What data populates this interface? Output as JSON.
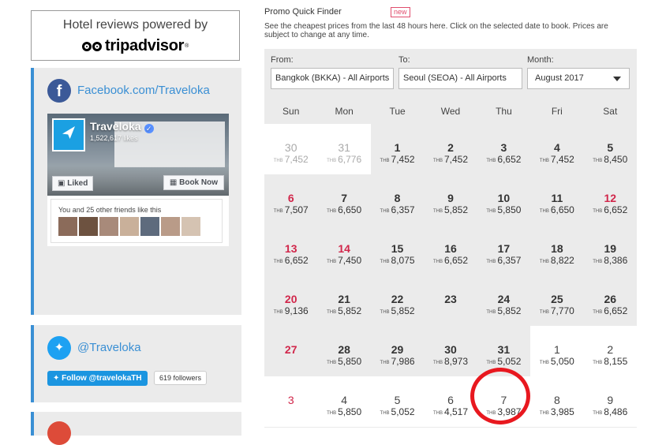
{
  "tripadvisor": {
    "title": "Hotel reviews powered by",
    "logo": "tripadvisor"
  },
  "facebook": {
    "link": "Facebook.com/Traveloka",
    "page_name": "Traveloka",
    "likes": "1,522,617 likes",
    "liked_label": "Liked",
    "book_label": "Book Now",
    "friends_text": "You and 25 other friends like this"
  },
  "twitter": {
    "link": "@Traveloka",
    "follow_label": "Follow @travelokaTH",
    "followers": "619 followers"
  },
  "promo": {
    "title": "Promo Quick Finder",
    "badge": "new",
    "description": "See the cheapest prices from the last 48 hours here. Click on the selected date to book. Prices are subject to change at any time.",
    "from_label": "From:",
    "from_value": "Bangkok (BKKA) - All Airports",
    "to_label": "To:",
    "to_value": "Seoul (SEOA) - All Airports",
    "month_label": "Month:",
    "month_value": "August 2017",
    "currency": "THB",
    "days": [
      "Sun",
      "Mon",
      "Tue",
      "Wed",
      "Thu",
      "Fri",
      "Sat"
    ],
    "weeks": [
      [
        {
          "d": "30",
          "p": "7,452",
          "s": "muted"
        },
        {
          "d": "31",
          "p": "6,776",
          "s": "muted"
        },
        {
          "d": "1",
          "p": "7,452",
          "s": ""
        },
        {
          "d": "2",
          "p": "7,452",
          "s": ""
        },
        {
          "d": "3",
          "p": "6,652",
          "s": ""
        },
        {
          "d": "4",
          "p": "7,452",
          "s": ""
        },
        {
          "d": "5",
          "p": "8,450",
          "s": ""
        }
      ],
      [
        {
          "d": "6",
          "p": "7,507",
          "s": "red"
        },
        {
          "d": "7",
          "p": "6,650",
          "s": ""
        },
        {
          "d": "8",
          "p": "6,357",
          "s": ""
        },
        {
          "d": "9",
          "p": "5,852",
          "s": ""
        },
        {
          "d": "10",
          "p": "5,850",
          "s": ""
        },
        {
          "d": "11",
          "p": "6,650",
          "s": ""
        },
        {
          "d": "12",
          "p": "6,652",
          "s": "red"
        }
      ],
      [
        {
          "d": "13",
          "p": "6,652",
          "s": "red"
        },
        {
          "d": "14",
          "p": "7,450",
          "s": "red"
        },
        {
          "d": "15",
          "p": "8,075",
          "s": ""
        },
        {
          "d": "16",
          "p": "6,652",
          "s": ""
        },
        {
          "d": "17",
          "p": "6,357",
          "s": ""
        },
        {
          "d": "18",
          "p": "8,822",
          "s": ""
        },
        {
          "d": "19",
          "p": "8,386",
          "s": ""
        }
      ],
      [
        {
          "d": "20",
          "p": "9,136",
          "s": "red"
        },
        {
          "d": "21",
          "p": "5,852",
          "s": ""
        },
        {
          "d": "22",
          "p": "5,852",
          "s": ""
        },
        {
          "d": "23",
          "p": "",
          "s": ""
        },
        {
          "d": "24",
          "p": "5,852",
          "s": ""
        },
        {
          "d": "25",
          "p": "7,770",
          "s": ""
        },
        {
          "d": "26",
          "p": "6,652",
          "s": ""
        }
      ],
      [
        {
          "d": "27",
          "p": "",
          "s": "red"
        },
        {
          "d": "28",
          "p": "5,850",
          "s": ""
        },
        {
          "d": "29",
          "p": "7,986",
          "s": ""
        },
        {
          "d": "30",
          "p": "8,973",
          "s": ""
        },
        {
          "d": "31",
          "p": "5,052",
          "s": ""
        },
        {
          "d": "1",
          "p": "5,050",
          "s": "light"
        },
        {
          "d": "2",
          "p": "8,155",
          "s": "light"
        }
      ],
      [
        {
          "d": "3",
          "p": "",
          "s": "light red"
        },
        {
          "d": "4",
          "p": "5,850",
          "s": "light"
        },
        {
          "d": "5",
          "p": "5,052",
          "s": "light"
        },
        {
          "d": "6",
          "p": "4,517",
          "s": "light"
        },
        {
          "d": "7",
          "p": "3,987",
          "s": "light"
        },
        {
          "d": "8",
          "p": "3,985",
          "s": "light"
        },
        {
          "d": "9",
          "p": "8,486",
          "s": "light"
        }
      ]
    ]
  },
  "colors": {
    "accent": "#3a8fd4",
    "weekend_red": "#d1264a",
    "highlight_circle": "#e8181f",
    "panel_gray": "#ebebeb"
  }
}
